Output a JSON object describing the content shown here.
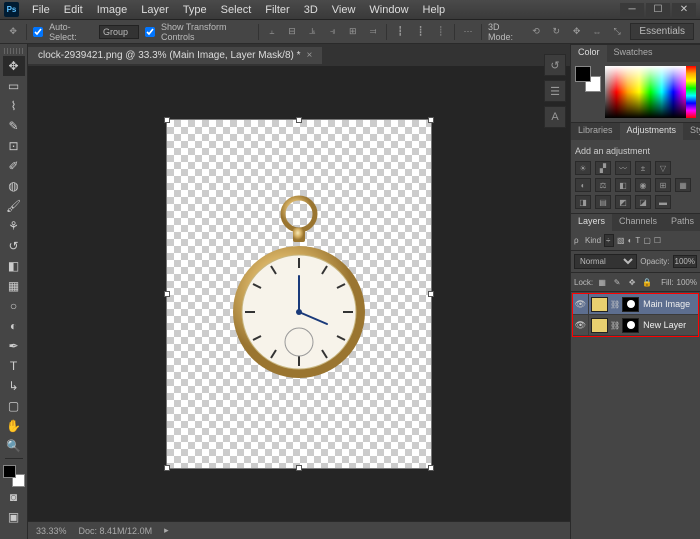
{
  "menu": [
    "File",
    "Edit",
    "Image",
    "Layer",
    "Type",
    "Select",
    "Filter",
    "3D",
    "View",
    "Window",
    "Help"
  ],
  "options": {
    "auto_select": "Auto-Select:",
    "auto_select_mode": "Group",
    "transform": "Show Transform Controls",
    "mode_label": "3D Mode:"
  },
  "workspace_preset": "Essentials",
  "document": {
    "tab": "clock-2939421.png @ 33.3% (Main Image, Layer Mask/8) *"
  },
  "status": {
    "zoom": "33.33%",
    "doc": "Doc: 8.41M/12.0M"
  },
  "panel_tabs": {
    "color": [
      "Color",
      "Swatches"
    ],
    "adjust": [
      "Libraries",
      "Adjustments",
      "Styles"
    ],
    "layers": [
      "Layers",
      "Channels",
      "Paths"
    ]
  },
  "adjustments": {
    "title": "Add an adjustment"
  },
  "layers": {
    "kind": "Kind",
    "blend": "Normal",
    "opacity_label": "Opacity:",
    "opacity": "100%",
    "lock": "Lock:",
    "fill_label": "Fill:",
    "fill": "100%",
    "items": [
      {
        "name": "Main Image"
      },
      {
        "name": "New Layer"
      }
    ]
  }
}
